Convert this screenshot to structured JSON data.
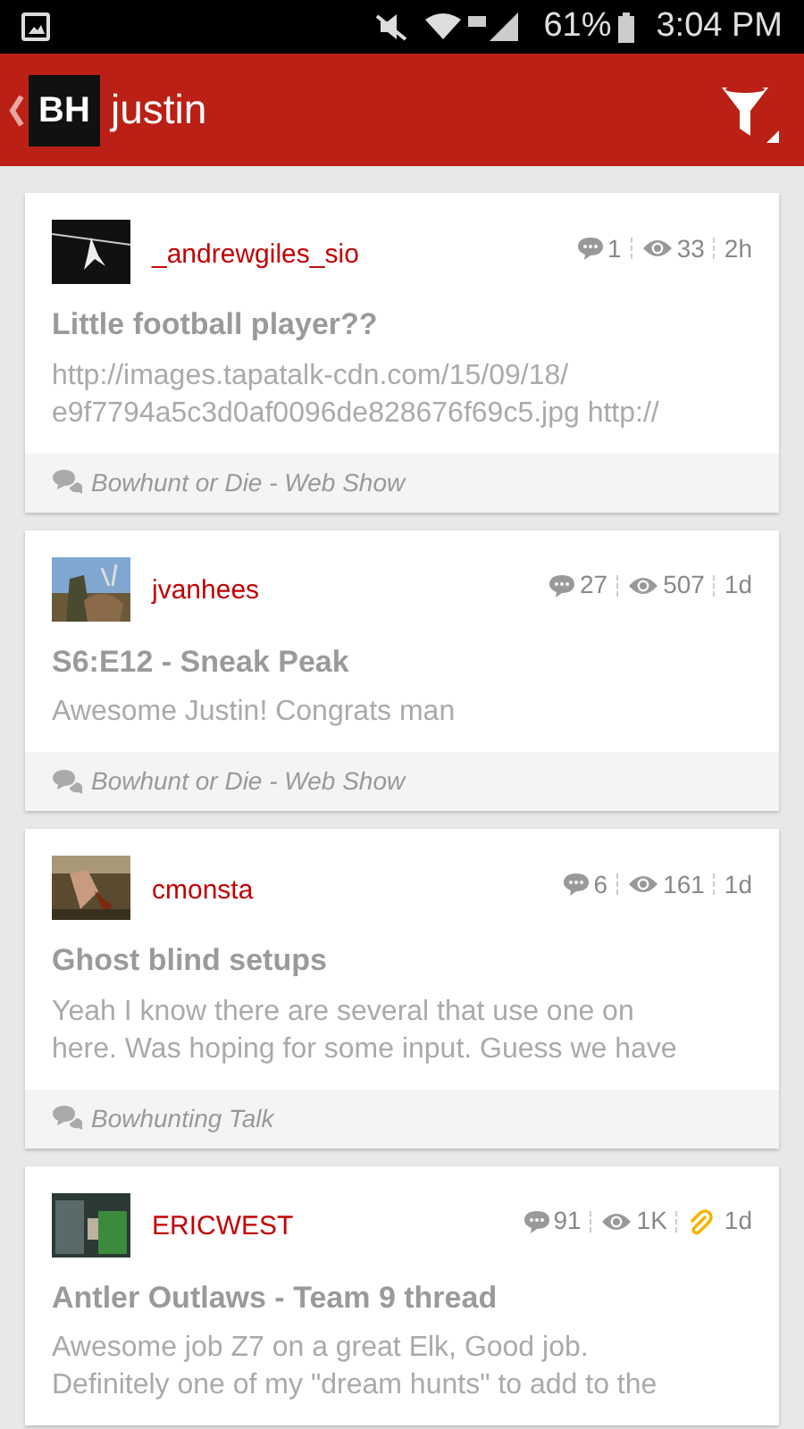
{
  "status_bar": {
    "battery": "61%",
    "time": "3:04 PM"
  },
  "header": {
    "logo_text": "BH",
    "title": "justin"
  },
  "topics": [
    {
      "author": "_andrewgiles_sio",
      "replies": "1",
      "views": "33",
      "attachment": false,
      "age": "2h",
      "title": "Little football player??",
      "body_lines": [
        "http://images.tapatalk-cdn.com/15/09/18/",
        "e9f7794a5c3d0af0096de828676f69c5.jpg http://"
      ],
      "forum": "Bowhunt or Die - Web Show",
      "avatar": {
        "kind": "picture"
      }
    },
    {
      "author": "jvanhees",
      "replies": "27",
      "views": "507",
      "attachment": false,
      "age": "1d",
      "title": "S6:E12 - Sneak Peak",
      "body_lines": [
        "Awesome Justin! Congrats man"
      ],
      "forum": "Bowhunt or Die - Web Show",
      "avatar": {
        "kind": "picture"
      }
    },
    {
      "author": "cmonsta",
      "replies": "6",
      "views": "161",
      "attachment": false,
      "age": "1d",
      "title": "Ghost blind setups",
      "body_lines": [
        "Yeah I know there are several that use one on",
        "here. Was hoping for some input. Guess we have"
      ],
      "forum": "Bowhunting Talk",
      "avatar": {
        "kind": "picture"
      }
    },
    {
      "author": "ERICWEST",
      "replies": "91",
      "views": "1K",
      "attachment": true,
      "age": "1d",
      "title": "Antler Outlaws - Team 9 thread",
      "body_lines": [
        "Awesome job Z7 on a great Elk, Good job.",
        "Definitely one of my \"dream hunts\" to add to the"
      ],
      "avatar": {
        "kind": "picture"
      }
    }
  ]
}
